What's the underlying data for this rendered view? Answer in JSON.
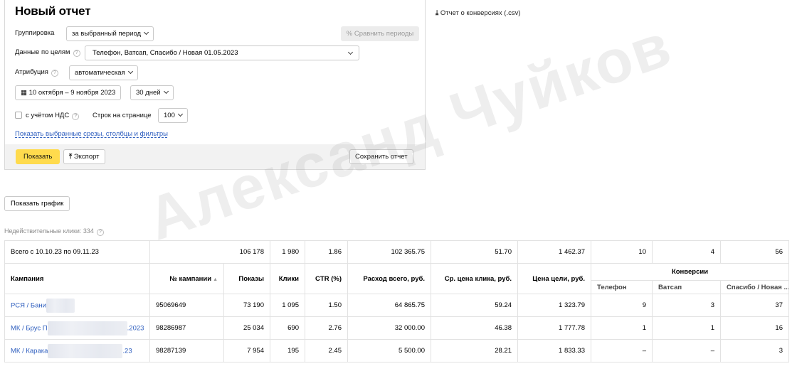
{
  "panel": {
    "title": "Новый отчет",
    "grouping_label": "Группировка",
    "grouping_value": "за выбранный период",
    "compare_label": "Сравнить периоды",
    "goals_label": "Данные по целям",
    "goals_value": "Телефон, Ватсап, Спасибо / Новая 01.05.2023",
    "attribution_label": "Атрибуция",
    "attribution_value": "автоматическая",
    "date_range": "10 октября – 9 ноября 2023",
    "period": "30 дней",
    "vat_label": "с учётом НДС",
    "rows_label": "Строк на странице",
    "rows_value": "100",
    "show_slices_link": "Показать выбранные срезы, столбцы и фильтры",
    "show_button": "Показать",
    "export_button": "Экспорт",
    "save_button": "Сохранить отчет"
  },
  "conversions_csv": "Отчет о конверсиях (.csv)",
  "show_graph": "Показать график",
  "invalid_clicks": "Недействительные клики: 334",
  "table": {
    "total": {
      "label": "Всего с 10.10.23 по 09.11.23",
      "impressions": "106 178",
      "clicks": "1 980",
      "ctr": "1.86",
      "cost": "102 365.75",
      "avg_cpc": "51.70",
      "cpa": "1 462.37",
      "conv_phone": "10",
      "conv_whatsapp": "4",
      "conv_thanks": "56"
    },
    "headers": {
      "campaign": "Кампания",
      "campaign_no": "№ кампании",
      "impressions": "Показы",
      "clicks": "Клики",
      "ctr": "CTR (%)",
      "cost": "Расход всего, руб.",
      "avg_cpc": "Ср. цена клика, руб.",
      "cpa": "Цена цели, руб.",
      "conversions": "Конверсии",
      "conv_phone": "Телефон",
      "conv_whatsapp": "Ватсап",
      "conv_thanks": "Спасибо / Новая ..."
    },
    "rows": [
      {
        "name_start": "РСЯ / Бани",
        "name_end": "",
        "number": "95069649",
        "impressions": "73 190",
        "clicks": "1 095",
        "ctr": "1.50",
        "cost": "64 865.75",
        "avg_cpc": "59.24",
        "cpa": "1 323.79",
        "conv_phone": "9",
        "conv_whatsapp": "3",
        "conv_thanks": "37"
      },
      {
        "name_start": "МК / Брус П",
        "name_end": ".2023",
        "number": "98286987",
        "impressions": "25 034",
        "clicks": "690",
        "ctr": "2.76",
        "cost": "32 000.00",
        "avg_cpc": "46.38",
        "cpa": "1 777.78",
        "conv_phone": "1",
        "conv_whatsapp": "1",
        "conv_thanks": "16"
      },
      {
        "name_start": "МК / Карака",
        "name_end": ".23",
        "number": "98287139",
        "impressions": "7 954",
        "clicks": "195",
        "ctr": "2.45",
        "cost": "5 500.00",
        "avg_cpc": "28.21",
        "cpa": "1 833.33",
        "conv_phone": "–",
        "conv_whatsapp": "–",
        "conv_thanks": "3"
      }
    ]
  },
  "watermark": "Александ Чуйков"
}
